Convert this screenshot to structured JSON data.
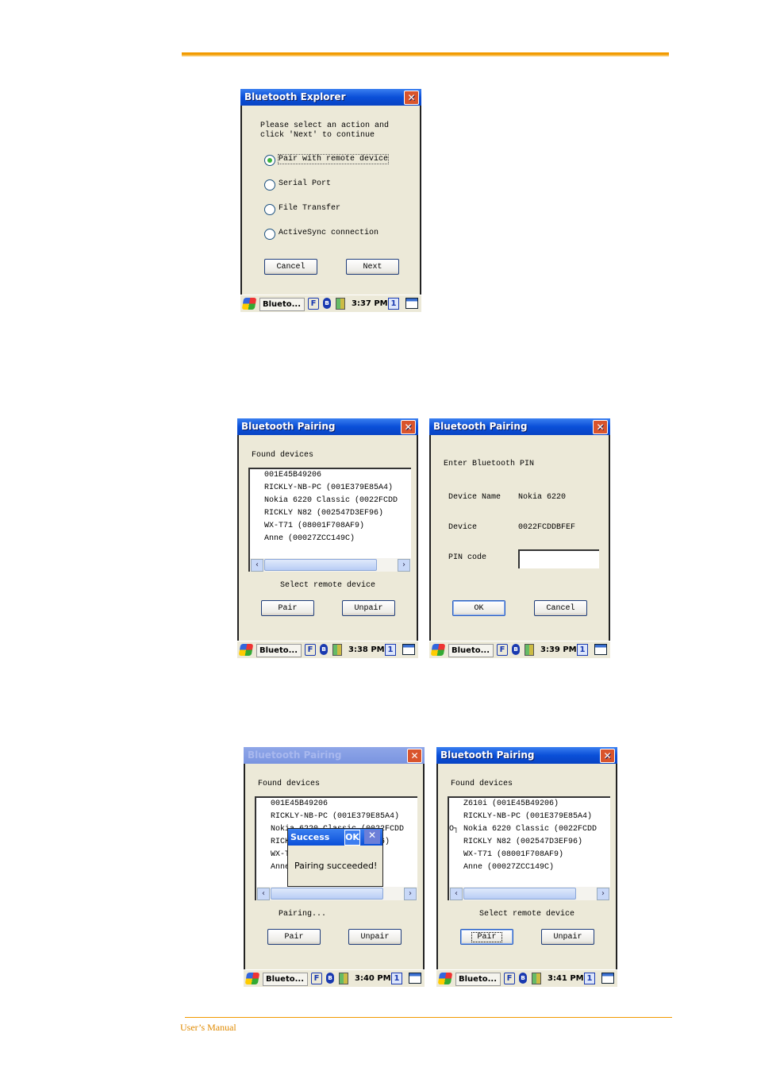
{
  "footer": {
    "text": "User’s Manual"
  },
  "colors": {
    "accent": "#f29a00",
    "titlebar": "#0a4fd8",
    "dialog_bg": "#ece9d8"
  },
  "windows": [
    {
      "kind": "explorer",
      "title": "Bluetooth Explorer",
      "active": true,
      "instruction": [
        "Please select an action and",
        "click 'Next'  to continue"
      ],
      "options": [
        {
          "label": "Pair with remote device",
          "selected": true
        },
        {
          "label": "Serial Port",
          "selected": false
        },
        {
          "label": "File Transfer",
          "selected": false
        },
        {
          "label": "ActiveSync connection",
          "selected": false
        }
      ],
      "buttons": [
        "Cancel",
        "Next"
      ],
      "taskbar": {
        "app": "Blueto...",
        "f": "F",
        "time": "3:37 PM",
        "desk": "1"
      }
    },
    {
      "kind": "list",
      "title": "Bluetooth Pairing",
      "active": true,
      "heading": "Found devices",
      "devices": [
        "001E45B49206",
        "RICKLY-NB-PC (001E379E85A4)",
        "Nokia 6220 Classic (0022FCDD",
        "RICKLY N82 (002547D3EF96)",
        "WX-T71 (08001F708AF9)",
        "Anne (00027ZCC149C)"
      ],
      "status": "Select remote device",
      "buttons": [
        "Pair",
        "Unpair"
      ],
      "taskbar": {
        "app": "Blueto...",
        "f": "F",
        "time": "3:38 PM",
        "desk": "1"
      }
    },
    {
      "kind": "pin",
      "title": "Bluetooth Pairing",
      "active": true,
      "heading": "Enter Bluetooth PIN",
      "device_name_label": "Device Name",
      "device_name": "Nokia 6220",
      "device_label": "Device",
      "device_address": "0022FCDDBFEF",
      "pin_label": "PIN code",
      "pin_value": "",
      "buttons": [
        "OK",
        "Cancel"
      ],
      "taskbar": {
        "app": "Blueto...",
        "f": "F",
        "time": "3:39 PM",
        "desk": "1"
      }
    },
    {
      "kind": "list",
      "title": "Bluetooth Pairing",
      "active": false,
      "heading": "Found devices",
      "devices": [
        "001E45B49206",
        "RICKLY-NB-PC (001E379E85A4)",
        "Nokia 6220 Classic (0022FCDD",
        "RICKLY N82 (002547D3EF96)",
        "WX-T71 (08001F708AF9)",
        "Anne (00027ZCC149C)"
      ],
      "status": "Pairing...",
      "buttons": [
        "Pair",
        "Unpair"
      ],
      "popup": {
        "title": "Success",
        "ok": "OK",
        "message": "Pairing succeeded!"
      },
      "taskbar": {
        "app": "Blueto...",
        "f": "F",
        "time": "3:40 PM",
        "desk": "1"
      }
    },
    {
      "kind": "list",
      "title": "Bluetooth Pairing",
      "active": true,
      "heading": "Found devices",
      "devices": [
        "Z610i (001E45B49206)",
        "RICKLY-NB-PC (001E379E85A4)",
        "Nokia 6220 Classic (0022FCDD",
        "RICKLY N82 (002547D3EF96)",
        "WX-T71 (08001F708AF9)",
        "Anne (00027ZCC149C)"
      ],
      "paired_index": 2,
      "status": "Select remote device",
      "buttons": [
        "Pair",
        "Unpair"
      ],
      "focused_button": 0,
      "taskbar": {
        "app": "Blueto...",
        "f": "F",
        "time": "3:41 PM",
        "desk": "1"
      }
    }
  ]
}
